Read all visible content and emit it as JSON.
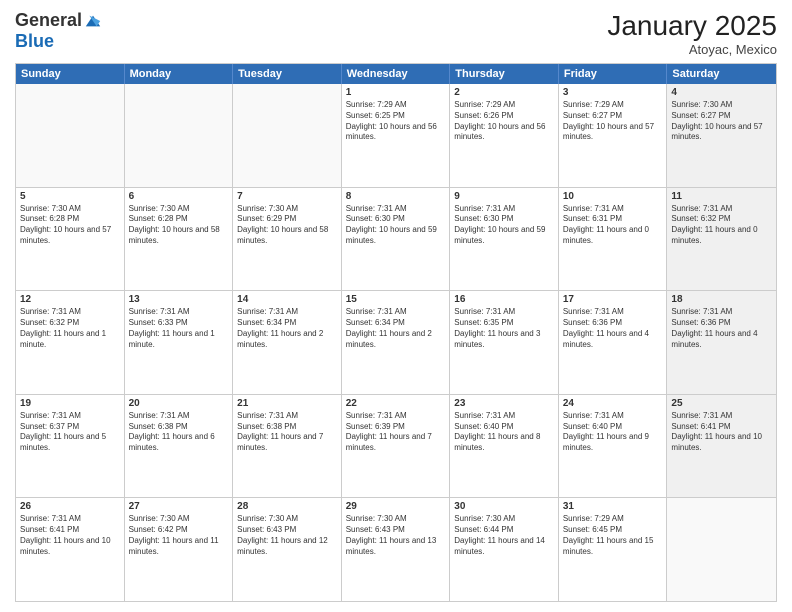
{
  "logo": {
    "general": "General",
    "blue": "Blue"
  },
  "title": "January 2025",
  "location": "Atoyac, Mexico",
  "header_days": [
    "Sunday",
    "Monday",
    "Tuesday",
    "Wednesday",
    "Thursday",
    "Friday",
    "Saturday"
  ],
  "rows": [
    [
      {
        "day": "",
        "text": "",
        "empty": true
      },
      {
        "day": "",
        "text": "",
        "empty": true
      },
      {
        "day": "",
        "text": "",
        "empty": true
      },
      {
        "day": "1",
        "text": "Sunrise: 7:29 AM\nSunset: 6:25 PM\nDaylight: 10 hours and 56 minutes."
      },
      {
        "day": "2",
        "text": "Sunrise: 7:29 AM\nSunset: 6:26 PM\nDaylight: 10 hours and 56 minutes."
      },
      {
        "day": "3",
        "text": "Sunrise: 7:29 AM\nSunset: 6:27 PM\nDaylight: 10 hours and 57 minutes."
      },
      {
        "day": "4",
        "text": "Sunrise: 7:30 AM\nSunset: 6:27 PM\nDaylight: 10 hours and 57 minutes.",
        "shaded": true
      }
    ],
    [
      {
        "day": "5",
        "text": "Sunrise: 7:30 AM\nSunset: 6:28 PM\nDaylight: 10 hours and 57 minutes."
      },
      {
        "day": "6",
        "text": "Sunrise: 7:30 AM\nSunset: 6:28 PM\nDaylight: 10 hours and 58 minutes."
      },
      {
        "day": "7",
        "text": "Sunrise: 7:30 AM\nSunset: 6:29 PM\nDaylight: 10 hours and 58 minutes."
      },
      {
        "day": "8",
        "text": "Sunrise: 7:31 AM\nSunset: 6:30 PM\nDaylight: 10 hours and 59 minutes."
      },
      {
        "day": "9",
        "text": "Sunrise: 7:31 AM\nSunset: 6:30 PM\nDaylight: 10 hours and 59 minutes."
      },
      {
        "day": "10",
        "text": "Sunrise: 7:31 AM\nSunset: 6:31 PM\nDaylight: 11 hours and 0 minutes."
      },
      {
        "day": "11",
        "text": "Sunrise: 7:31 AM\nSunset: 6:32 PM\nDaylight: 11 hours and 0 minutes.",
        "shaded": true
      }
    ],
    [
      {
        "day": "12",
        "text": "Sunrise: 7:31 AM\nSunset: 6:32 PM\nDaylight: 11 hours and 1 minute."
      },
      {
        "day": "13",
        "text": "Sunrise: 7:31 AM\nSunset: 6:33 PM\nDaylight: 11 hours and 1 minute."
      },
      {
        "day": "14",
        "text": "Sunrise: 7:31 AM\nSunset: 6:34 PM\nDaylight: 11 hours and 2 minutes."
      },
      {
        "day": "15",
        "text": "Sunrise: 7:31 AM\nSunset: 6:34 PM\nDaylight: 11 hours and 2 minutes."
      },
      {
        "day": "16",
        "text": "Sunrise: 7:31 AM\nSunset: 6:35 PM\nDaylight: 11 hours and 3 minutes."
      },
      {
        "day": "17",
        "text": "Sunrise: 7:31 AM\nSunset: 6:36 PM\nDaylight: 11 hours and 4 minutes."
      },
      {
        "day": "18",
        "text": "Sunrise: 7:31 AM\nSunset: 6:36 PM\nDaylight: 11 hours and 4 minutes.",
        "shaded": true
      }
    ],
    [
      {
        "day": "19",
        "text": "Sunrise: 7:31 AM\nSunset: 6:37 PM\nDaylight: 11 hours and 5 minutes."
      },
      {
        "day": "20",
        "text": "Sunrise: 7:31 AM\nSunset: 6:38 PM\nDaylight: 11 hours and 6 minutes."
      },
      {
        "day": "21",
        "text": "Sunrise: 7:31 AM\nSunset: 6:38 PM\nDaylight: 11 hours and 7 minutes."
      },
      {
        "day": "22",
        "text": "Sunrise: 7:31 AM\nSunset: 6:39 PM\nDaylight: 11 hours and 7 minutes."
      },
      {
        "day": "23",
        "text": "Sunrise: 7:31 AM\nSunset: 6:40 PM\nDaylight: 11 hours and 8 minutes."
      },
      {
        "day": "24",
        "text": "Sunrise: 7:31 AM\nSunset: 6:40 PM\nDaylight: 11 hours and 9 minutes."
      },
      {
        "day": "25",
        "text": "Sunrise: 7:31 AM\nSunset: 6:41 PM\nDaylight: 11 hours and 10 minutes.",
        "shaded": true
      }
    ],
    [
      {
        "day": "26",
        "text": "Sunrise: 7:31 AM\nSunset: 6:41 PM\nDaylight: 11 hours and 10 minutes."
      },
      {
        "day": "27",
        "text": "Sunrise: 7:30 AM\nSunset: 6:42 PM\nDaylight: 11 hours and 11 minutes."
      },
      {
        "day": "28",
        "text": "Sunrise: 7:30 AM\nSunset: 6:43 PM\nDaylight: 11 hours and 12 minutes."
      },
      {
        "day": "29",
        "text": "Sunrise: 7:30 AM\nSunset: 6:43 PM\nDaylight: 11 hours and 13 minutes."
      },
      {
        "day": "30",
        "text": "Sunrise: 7:30 AM\nSunset: 6:44 PM\nDaylight: 11 hours and 14 minutes."
      },
      {
        "day": "31",
        "text": "Sunrise: 7:29 AM\nSunset: 6:45 PM\nDaylight: 11 hours and 15 minutes."
      },
      {
        "day": "",
        "text": "",
        "empty": true,
        "shaded": true
      }
    ]
  ]
}
